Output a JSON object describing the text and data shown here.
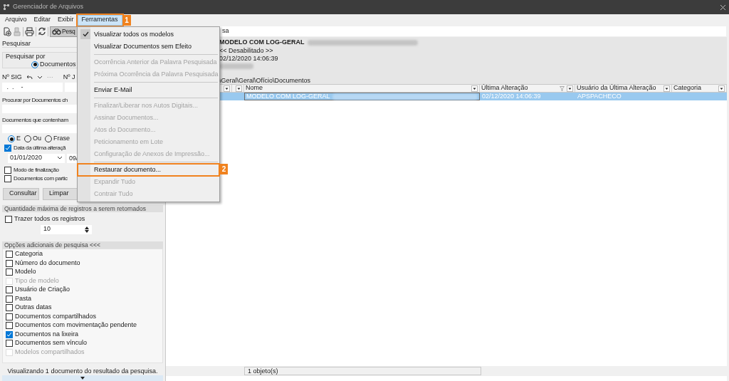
{
  "window": {
    "title": "Gerenciador de Arquivos"
  },
  "menu_bar": [
    {
      "label": "Arquivo",
      "selected": false
    },
    {
      "label": "Editar",
      "selected": false
    },
    {
      "label": "Exibir",
      "selected": false
    },
    {
      "label": "Ferramentas",
      "selected": true,
      "callout": "1"
    }
  ],
  "toolbar": {
    "search_button": {
      "label": "Pesq",
      "selected": true
    },
    "search_field": {
      "value": "sa"
    }
  },
  "left_panel": {
    "header": "Pesquisar",
    "search_by": {
      "label": "Pesquisar por",
      "option": {
        "label": "Documentos",
        "selected": true
      }
    },
    "sig_label": "Nº SIG",
    "sig_more": "···",
    "second_label": "Nº J",
    "sig_value": " .  .    -",
    "find_label": "Procurar por Documentos ch",
    "contains_label": "Documentos que contenham",
    "match_options": [
      {
        "label": "E",
        "selected": true
      },
      {
        "label": "Ou",
        "selected": false
      },
      {
        "label": "Frase",
        "selected": false
      }
    ],
    "date_filter": {
      "label": "Data da última alteraçã",
      "checked": true,
      "from": "01/01/2020",
      "to": "09/"
    },
    "options": [
      {
        "label": "Modo de finalização",
        "checked": false
      },
      {
        "label": "Documentos com partic",
        "checked": false
      }
    ],
    "buttons": [
      "Consultar",
      "Limpar"
    ],
    "max_section": "Quantidade máxima de registros a serem retornados",
    "all_records": {
      "label": "Trazer todos os registros",
      "checked": false
    },
    "max_value": "10",
    "extra_section": "Opções adicionais de pesquisa <<<",
    "extra_options": [
      {
        "label": "Categoria",
        "checked": false,
        "disabled": false
      },
      {
        "label": "Número do documento",
        "checked": false,
        "disabled": false
      },
      {
        "label": "Modelo",
        "checked": false,
        "disabled": false
      },
      {
        "label": "Tipo de modelo",
        "checked": false,
        "disabled": true
      },
      {
        "label": "Usuário de Criação",
        "checked": false,
        "disabled": false
      },
      {
        "label": "Pasta",
        "checked": false,
        "disabled": false
      },
      {
        "label": "Outras datas",
        "checked": false,
        "disabled": false
      },
      {
        "label": "Documentos compartilhados",
        "checked": false,
        "disabled": false
      },
      {
        "label": "Documentos com movimentação pendente",
        "checked": false,
        "disabled": false
      },
      {
        "label": "Documentos na lixeira",
        "checked": true,
        "disabled": false
      },
      {
        "label": "Documentos sem vínculo",
        "checked": false,
        "disabled": false
      },
      {
        "label": "Modelos compartilhados",
        "checked": false,
        "disabled": true
      }
    ],
    "status": "Visualizando 1 documento do resultado da pesquisa."
  },
  "preview": {
    "title": "MODELO COM LOG-GERAL",
    "title_redacted": true,
    "state": "<< Desabilitado >>",
    "date": "02/12/2020 14:06:39",
    "extra_redacted": true,
    "path": "\\Geral\\Geral\\Ofício\\Documentos"
  },
  "table": {
    "columns": [
      "Nome",
      "Última Alteração",
      "Usuário da Última Alteração",
      "Categoria"
    ],
    "rows": [
      {
        "selected": true,
        "name": "MODELO COM LOG-GERAL",
        "name_redacted": true,
        "modified": "02/12/2020 14:06:39",
        "modified_by": "APSPACHECO"
      }
    ]
  },
  "status_bar": {
    "count": "1 objeto(s)"
  },
  "dropdown_menu": {
    "items": [
      {
        "label": "Visualizar todos os modelos",
        "checked": true,
        "disabled": false,
        "separator_after": false
      },
      {
        "label": "Visualizar Documentos sem Efeito",
        "checked": false,
        "disabled": false,
        "separator_after": true
      },
      {
        "label": "Ocorrência Anterior da Palavra Pesquisada",
        "checked": false,
        "disabled": true,
        "separator_after": false
      },
      {
        "label": "Próxima Ocorrência da Palavra Pesquisada",
        "checked": false,
        "disabled": true,
        "separator_after": true
      },
      {
        "label": "Enviar E-Mail",
        "checked": false,
        "disabled": false,
        "separator_after": true
      },
      {
        "label": "Finalizar/Liberar nos Autos Digitais...",
        "checked": false,
        "disabled": true,
        "separator_after": false
      },
      {
        "label": "Assinar Documentos...",
        "checked": false,
        "disabled": true,
        "separator_after": false
      },
      {
        "label": "Atos do Documento...",
        "checked": false,
        "disabled": true,
        "separator_after": false
      },
      {
        "label": "Peticionamento em Lote",
        "checked": false,
        "disabled": true,
        "separator_after": false
      },
      {
        "label": "Configuração de Anexos de Impressão...",
        "checked": false,
        "disabled": true,
        "separator_after": true
      },
      {
        "label": "Restaurar documento...",
        "checked": false,
        "disabled": false,
        "separator_after": false,
        "callout": "2"
      },
      {
        "label": "Expandir Tudo",
        "checked": false,
        "disabled": true,
        "separator_after": false
      },
      {
        "label": "Contrair Tudo",
        "checked": false,
        "disabled": true,
        "separator_after": false
      }
    ]
  }
}
